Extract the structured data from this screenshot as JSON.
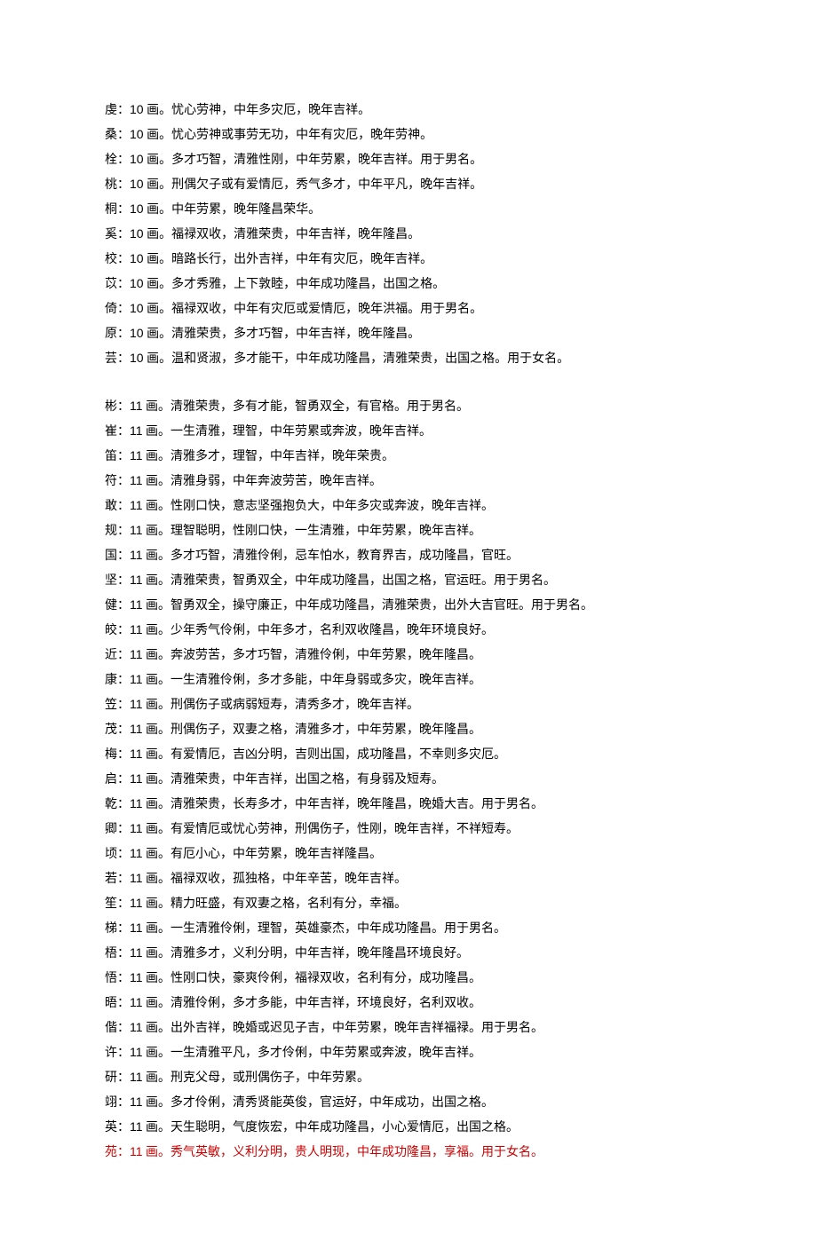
{
  "group10": [
    {
      "char": "虔",
      "strokes": "10",
      "desc": "忧心劳神，中年多灾厄，晚年吉祥。"
    },
    {
      "char": "桑",
      "strokes": "10",
      "desc": "忧心劳神或事劳无功，中年有灾厄，晚年劳神。"
    },
    {
      "char": "栓",
      "strokes": "10",
      "desc": "多才巧智，清雅性刚，中年劳累，晚年吉祥。用于男名。"
    },
    {
      "char": "桃",
      "strokes": "10",
      "desc": "刑偶欠子或有爱情厄，秀气多才，中年平凡，晚年吉祥。"
    },
    {
      "char": "桐",
      "strokes": "10",
      "desc": "中年劳累，晚年隆昌荣华。"
    },
    {
      "char": "奚",
      "strokes": "10",
      "desc": "福禄双收，清雅荣贵，中年吉祥，晚年隆昌。"
    },
    {
      "char": "校",
      "strokes": "10",
      "desc": "暗路长行，出外吉祥，中年有灾厄，晚年吉祥。"
    },
    {
      "char": "苡",
      "strokes": "10",
      "desc": "多才秀雅，上下敦睦，中年成功隆昌，出国之格。"
    },
    {
      "char": "倚",
      "strokes": "10",
      "desc": "福禄双收，中年有灾厄或爱情厄，晚年洪福。用于男名。"
    },
    {
      "char": "原",
      "strokes": "10",
      "desc": "清雅荣贵，多才巧智，中年吉祥，晚年隆昌。"
    },
    {
      "char": "芸",
      "strokes": "10",
      "desc": "温和贤淑，多才能干，中年成功隆昌，清雅荣贵，出国之格。用于女名。"
    }
  ],
  "group11": [
    {
      "char": "彬",
      "strokes": "11",
      "desc": "清雅荣贵，多有才能，智勇双全，有官格。用于男名。",
      "suffix": " "
    },
    {
      "char": "崔",
      "strokes": "11",
      "desc": "一生清雅，理智，中年劳累或奔波，晚年吉祥。",
      "suffix": " "
    },
    {
      "char": "笛",
      "strokes": "11",
      "desc": "清雅多才，理智，中年吉祥，晚年荣贵。",
      "suffix": " "
    },
    {
      "char": "符",
      "strokes": "11",
      "desc": "清雅身弱，中年奔波劳苦，晚年吉祥。",
      "suffix": " "
    },
    {
      "char": "敢",
      "strokes": "11",
      "desc": "性刚口快，意志坚强抱负大，中年多灾或奔波，晚年吉祥。",
      "suffix": " "
    },
    {
      "char": "规",
      "strokes": "11",
      "desc": "理智聪明，性刚口快，一生清雅，中年劳累，晚年吉祥。",
      "suffix": " "
    },
    {
      "char": "国",
      "strokes": "11",
      "desc": "多才巧智，清雅伶俐，忌车怕水，教育界吉，成功隆昌，官旺。",
      "suffix": " "
    },
    {
      "char": "坚",
      "strokes": "11",
      "desc": "清雅荣贵，智勇双全，中年成功隆昌，出国之格，官运旺。用于男名。",
      "suffix": " "
    },
    {
      "char": "健",
      "strokes": "11",
      "desc": "智勇双全，操守廉正，中年成功隆昌，清雅荣贵，出外大吉官旺。用于男名。",
      "suffix": " "
    },
    {
      "char": "皎",
      "strokes": "11",
      "desc": "少年秀气伶俐，中年多才，名利双收隆昌，晚年环境良好。",
      "suffix": " "
    },
    {
      "char": "近",
      "strokes": "11",
      "desc": "奔波劳苦，多才巧智，清雅伶俐，中年劳累，晚年隆昌。",
      "suffix": " "
    },
    {
      "char": "康",
      "strokes": "11",
      "desc": "一生清雅伶俐，多才多能，中年身弱或多灾，晚年吉祥。",
      "suffix": " "
    },
    {
      "char": "笠",
      "strokes": "11",
      "desc": "刑偶伤子或病弱短寿，清秀多才，晚年吉祥。",
      "suffix": " "
    },
    {
      "char": "茂",
      "strokes": "11",
      "desc": "刑偶伤子，双妻之格，清雅多才，中年劳累，晚年隆昌。",
      "suffix": " "
    },
    {
      "char": "梅",
      "strokes": "11",
      "desc": "有爱情厄，吉凶分明，吉则出国，成功隆昌，不幸则多灾厄。",
      "suffix": " "
    },
    {
      "char": "启",
      "strokes": "11",
      "desc": "清雅荣贵，中年吉祥，出国之格，有身弱及短寿。",
      "suffix": " "
    },
    {
      "char": "乾",
      "strokes": "11",
      "desc": "清雅荣贵，长寿多才，中年吉祥，晚年隆昌，晚婚大吉。用于男名。",
      "suffix": " "
    },
    {
      "char": "卿",
      "strokes": "11",
      "desc": "有爱情厄或忧心劳神，刑偶伤子，性刚，晚年吉祥，不祥短寿。",
      "suffix": " "
    },
    {
      "char": "顷",
      "strokes": "11",
      "desc": "有厄小心，中年劳累，晚年吉祥隆昌。",
      "suffix": " "
    },
    {
      "char": "若",
      "strokes": "11",
      "desc": "福禄双收，孤独格，中年辛苦，晚年吉祥。"
    },
    {
      "char": "笙",
      "strokes": "11",
      "desc": "精力旺盛，有双妻之格，名利有分，幸福。",
      "suffix": " "
    },
    {
      "char": "梯",
      "strokes": "11",
      "desc": "一生清雅伶俐，理智，英雄豪杰，中年成功隆昌。用于男名。",
      "suffix": " "
    },
    {
      "char": "梧",
      "strokes": "11",
      "desc": "清雅多才，义利分明，中年吉祥，晚年隆昌环境良好。",
      "suffix": " "
    },
    {
      "char": "悟",
      "strokes": "11",
      "desc": "性刚口快，豪爽伶俐，福禄双收，名利有分，成功隆昌。",
      "suffix": " "
    },
    {
      "char": "晤",
      "strokes": "11",
      "desc": "清雅伶俐，多才多能，中年吉祥，环境良好，名利双收。",
      "suffix": " "
    },
    {
      "char": "偕",
      "strokes": "11",
      "desc": "出外吉祥，晚婚或迟见子吉，中年劳累，晚年吉祥福禄。用于男名。",
      "suffix": " "
    },
    {
      "char": "许",
      "strokes": "11",
      "desc": "一生清雅平凡，多才伶俐，中年劳累或奔波，晚年吉祥。",
      "suffix": " "
    },
    {
      "char": "研",
      "strokes": "11",
      "desc": "刑克父母，或刑偶伤子，中年劳累。",
      "suffix": " "
    },
    {
      "char": "翊",
      "strokes": "11",
      "desc": "多才伶俐，清秀贤能英俊，官运好，中年成功，出国之格。",
      "suffix": " "
    },
    {
      "char": "英",
      "strokes": "11",
      "desc": "天生聪明，气度恢宏，中年成功隆昌，小心爱情厄，出国之格。",
      "suffix": " "
    },
    {
      "char": "苑",
      "strokes": "11",
      "desc": "秀气英敏，义利分明，贵人明现，中年成功隆昌，享福。用于女名。",
      "highlight": true
    }
  ],
  "strokeLabel": "画。"
}
